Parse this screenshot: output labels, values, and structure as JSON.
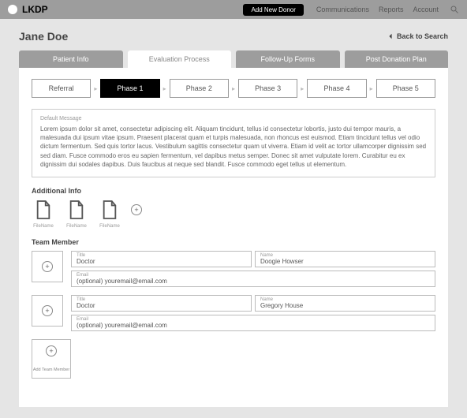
{
  "topbar": {
    "logo": "LKDP",
    "add_donor": "Add New Donor",
    "links": [
      "Communications",
      "Reports",
      "Account"
    ]
  },
  "header": {
    "title": "Jane Doe",
    "back": "Back to Search"
  },
  "tabs": [
    "Patient Info",
    "Evaluation Process",
    "Follow-Up Forms",
    "Post Donation Plan"
  ],
  "active_tab": 1,
  "phases": [
    "Referral",
    "Phase 1",
    "Phase 2",
    "Phase 3",
    "Phase 4",
    "Phase 5"
  ],
  "active_phase": 1,
  "default_message": {
    "label": "Default Message",
    "text": "Lorem ipsum dolor sit amet, consectetur adipiscing elit. Aliquam tincidunt, tellus id consectetur lobortis, justo dui tempor mauris, a malesuada dui ipsum vitae ipsum. Praesent placerat quam et turpis malesuada, non rhoncus est euismod. Etiam tincidunt tellus vel odio dictum fermentum. Sed quis tortor lacus. Vestibulum sagittis consectetur quam ut viverra. Etiam id velit ac tortor ullamcorper dignissim sed sed diam. Fusce commodo eros eu sapien fermentum, vel dapibus metus semper. Donec sit amet vulputate lorem. Curabitur eu ex dignissim dui sodales dapibus. Duis faucibus at neque sed blandit. Fusce commodo eget tellus ut elementum."
  },
  "additional_info": {
    "title": "Additional Info",
    "files": [
      "FileName",
      "FileName",
      "FileName"
    ]
  },
  "team": {
    "title": "Team Member",
    "title_label": "Title",
    "name_label": "Name",
    "email_label": "Email",
    "email_placeholder": "(optional) youremail@email.com",
    "members": [
      {
        "title": "Doctor",
        "name": "Doogie Howser",
        "email": ""
      },
      {
        "title": "Doctor",
        "name": "Gregory House",
        "email": ""
      }
    ],
    "add_label": "Add Team Member"
  }
}
